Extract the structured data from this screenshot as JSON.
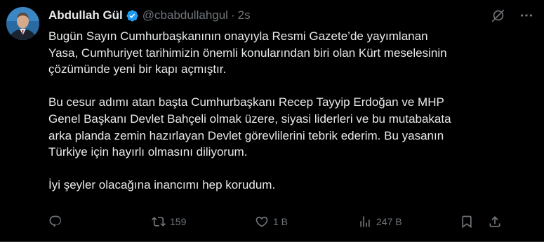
{
  "author": {
    "name": "Abdullah Gül",
    "handle": "@cbabdullahgul",
    "separator": "·",
    "time": "2s",
    "verified": true,
    "verified_color": "#1d9bf0"
  },
  "tweet": {
    "paragraphs": [
      "Bugün Sayın Cumhurbaşkanının onayıyla Resmi Gazete’de yayımlanan\nYasa, Cumhuriyet tarihimizin önemli konularından biri olan Kürt meselesinin\nçözümünde yeni bir kapı açmıştır.",
      "Bu cesur adımı atan başta Cumhurbaşkanı Recep Tayyip Erdoğan ve MHP\nGenel Başkanı Devlet Bahçeli olmak üzere, siyasi liderleri ve bu mutabakata\narka planda zemin hazırlayan Devlet görevlilerini tebrik ederim. Bu yasanın\nTürkiye için hayırlı olmasını diliyorum.",
      "İyi şeyler olacağına inancımı hep korudum."
    ]
  },
  "actions": {
    "reply_count": "",
    "retweet_count": "159",
    "like_count": "1 B",
    "views_count": "247 B"
  },
  "icons": {
    "top": [
      "grok-icon",
      "more-icon"
    ],
    "actions": [
      "reply-icon",
      "retweet-icon",
      "like-icon",
      "views-icon",
      "bookmark-icon",
      "share-icon"
    ]
  },
  "colors": {
    "background": "#000000",
    "text": "#e7e9ea",
    "muted": "#71767b",
    "accent": "#1d9bf0"
  }
}
